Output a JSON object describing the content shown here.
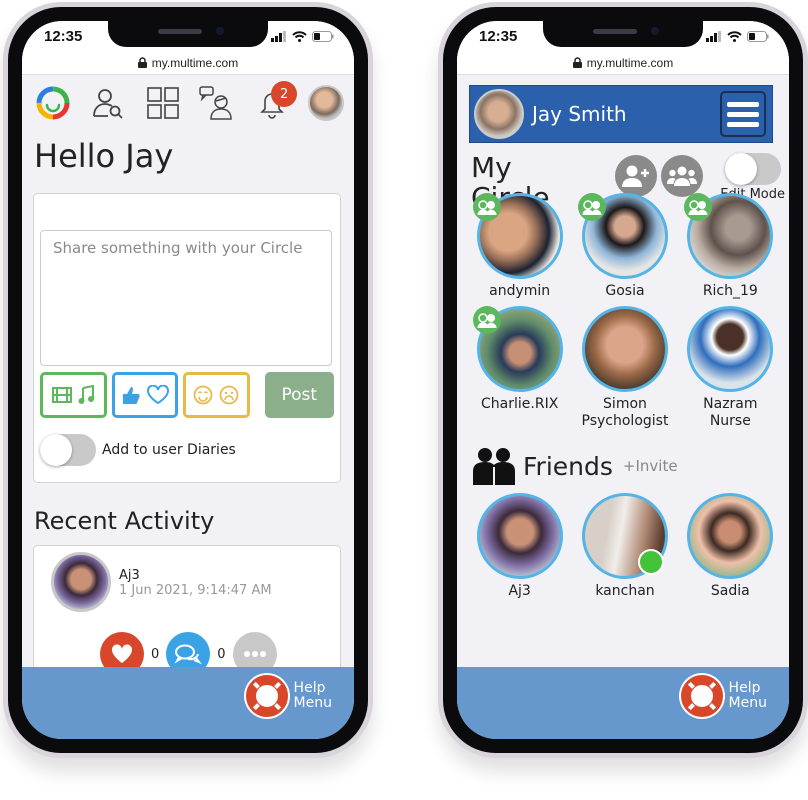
{
  "device": {
    "time": "12:35",
    "url": "my.multime.com"
  },
  "home": {
    "greeting": "Hello Jay",
    "notifications_count": "2",
    "post": {
      "placeholder": "Share something with your Circle",
      "value": "",
      "post_label": "Post",
      "diary_toggle_label": "Add to user Diaries",
      "diary_toggle_on": false
    },
    "recent_activity": {
      "title": "Recent Activity",
      "items": [
        {
          "author": "Aj3",
          "timestamp": "1 Jun 2021, 9:14:47 AM",
          "likes": "0",
          "comments": "0"
        }
      ]
    },
    "help": {
      "line1": "Help",
      "line2": "Menu"
    }
  },
  "circle": {
    "user_name": "Jay Smith",
    "title_line1": "My",
    "title_line2": "Circle",
    "edit_mode_label": "Edit Mode",
    "edit_mode_on": false,
    "members": [
      {
        "name": "andymin",
        "group_badge": true
      },
      {
        "name": "Gosia",
        "group_badge": true
      },
      {
        "name": "Rich_19",
        "group_badge": true
      },
      {
        "name": "Charlie.RIX",
        "group_badge": true
      },
      {
        "name": "Simon Psychologist",
        "line1": "Simon",
        "line2": "Psychologist",
        "group_badge": false
      },
      {
        "name": "Nazram Nurse",
        "line1": "Nazram",
        "line2": "Nurse",
        "group_badge": false
      }
    ],
    "friends_title": "Friends",
    "invite_label": "+Invite",
    "friends": [
      {
        "name": "Aj3",
        "online": false
      },
      {
        "name": "kanchan",
        "online": true
      },
      {
        "name": "Sadia",
        "online": false
      }
    ],
    "help": {
      "line1": "Help",
      "line2": "Menu"
    }
  },
  "colors": {
    "accent_blue": "#2b60ad",
    "help_bar": "#6697cd",
    "ring": "#55b4e6",
    "badge_red": "#d9472b",
    "group_green": "#5cb85c",
    "online_green": "#44c23a"
  }
}
